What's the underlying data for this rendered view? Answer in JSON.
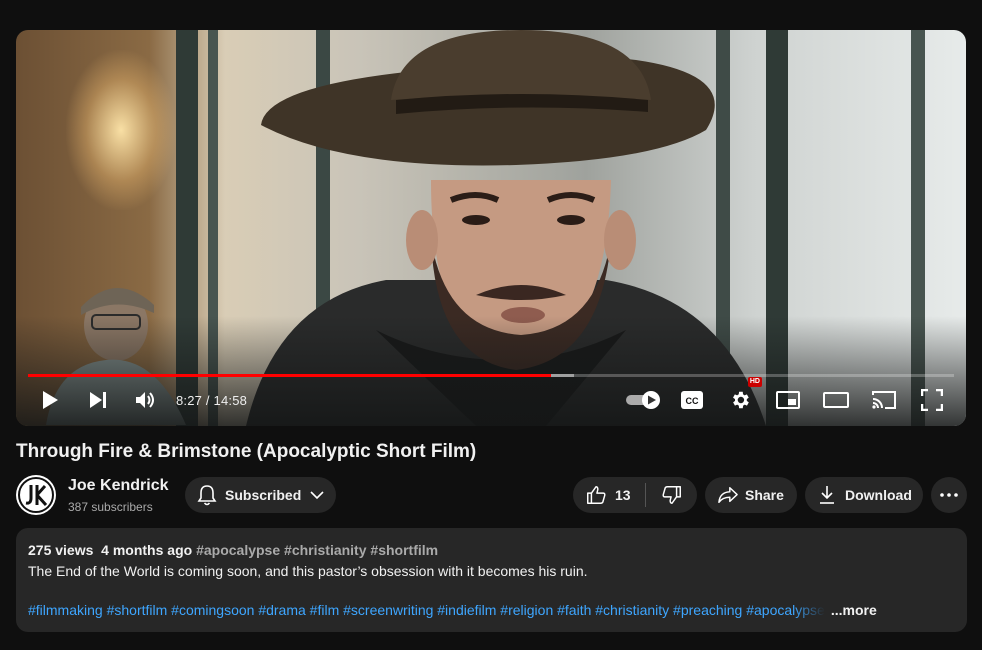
{
  "player": {
    "current_time": "8:27",
    "duration": "14:58",
    "time_display": "8:27 / 14:58",
    "played_fraction": 0.565,
    "buffered_fraction": 0.59,
    "hd_badge": "HD",
    "accent_color": "#ff0000"
  },
  "video": {
    "title": "Through Fire & Brimstone (Apocalyptic Short Film)"
  },
  "channel": {
    "name": "Joe Kendrick",
    "subscribers": "387 subscribers",
    "avatar_initials": "JK"
  },
  "actions": {
    "subscribe_label": "Subscribed",
    "like_count": "13",
    "share_label": "Share",
    "download_label": "Download"
  },
  "description": {
    "views": "275 views",
    "age": "4 months ago",
    "header_tags": [
      "#apocalypse",
      "#christianity",
      "#shortfilm"
    ],
    "text": "The End of the World is coming soon, and this pastor’s obsession with it becomes his ruin.",
    "tags": "#filmmaking #shortfilm #comingsoon #drama #film #screenwriting #indiefilm #religion #faith #christianity #preaching #apocalypse",
    "more_label": "...more"
  },
  "icons": {
    "play": "play-icon",
    "next": "next-icon",
    "volume": "volume-icon",
    "autoplay": "autoplay-toggle-icon",
    "captions": "captions-icon",
    "settings": "gear-icon",
    "miniplayer": "miniplayer-icon",
    "theater": "theater-icon",
    "cast": "cast-icon",
    "fullscreen": "fullscreen-icon",
    "bell": "bell-icon",
    "like": "thumbs-up-icon",
    "dislike": "thumbs-down-icon",
    "share": "share-arrow-icon",
    "download": "download-icon",
    "more": "more-horizontal-icon"
  }
}
